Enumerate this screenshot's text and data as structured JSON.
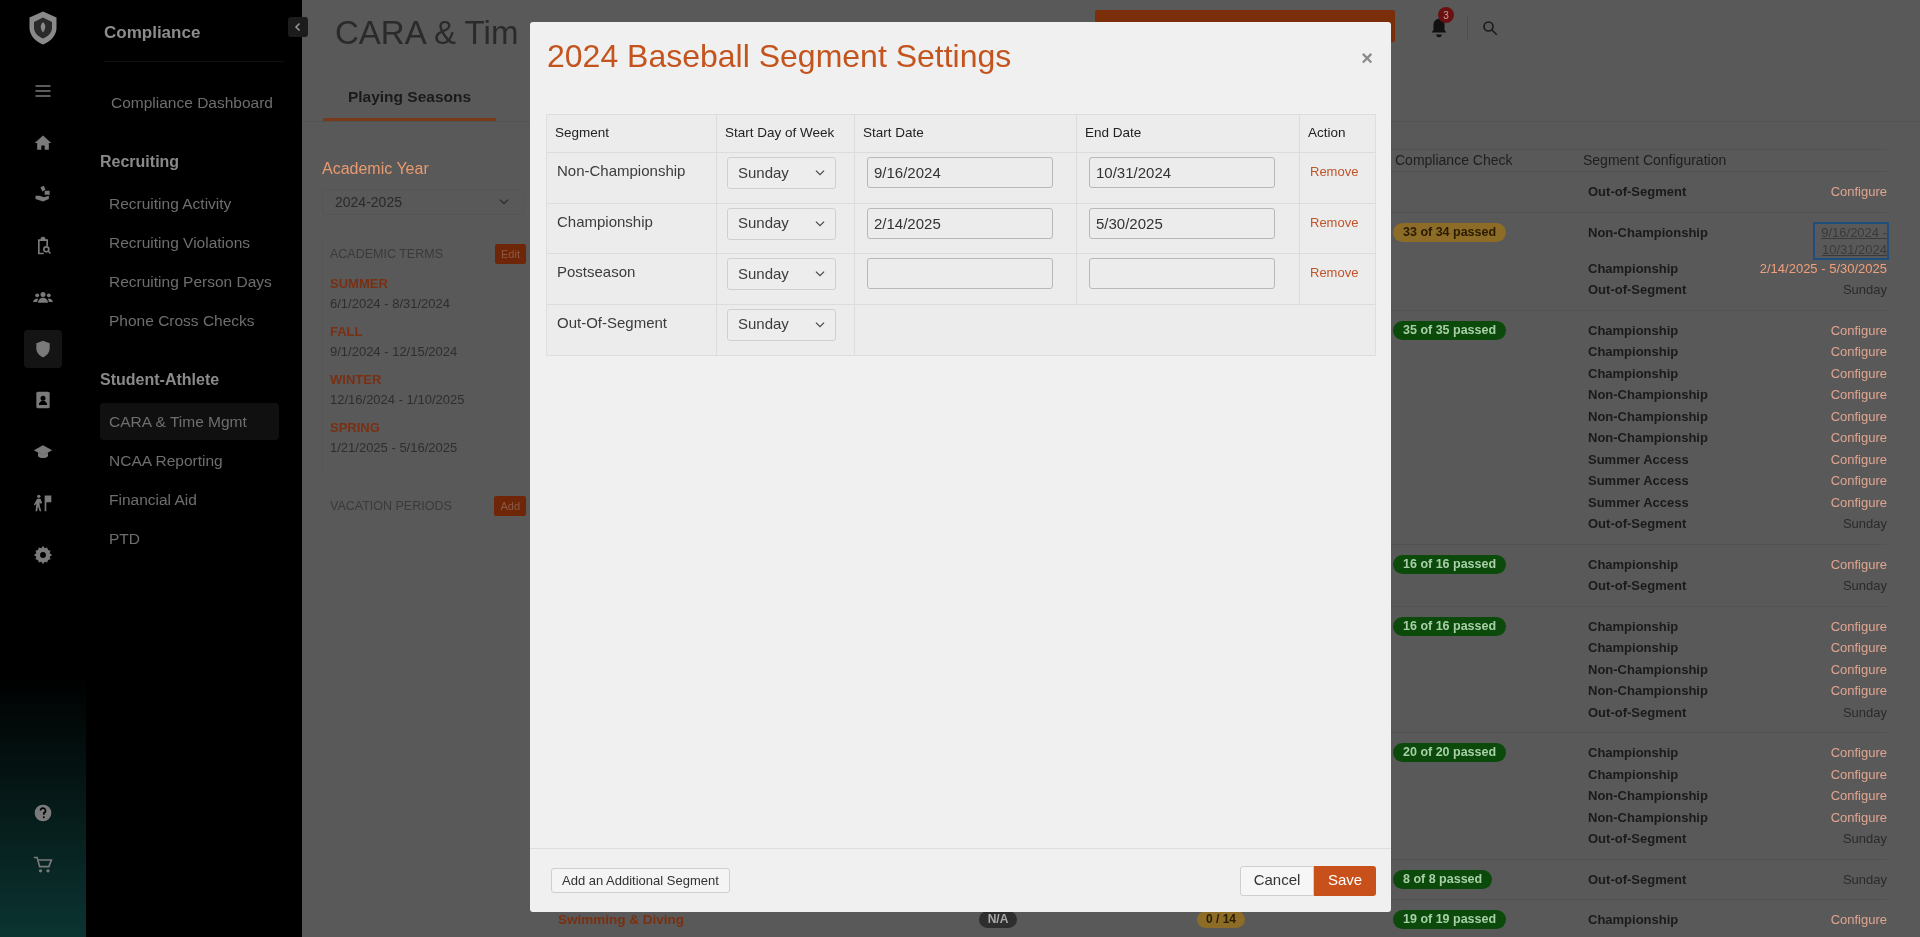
{
  "rail": {
    "top": [
      {
        "selected": false
      },
      {
        "selected": false
      },
      {
        "selected": false
      },
      {
        "selected": false
      },
      {
        "selected": false
      },
      {
        "selected": true
      },
      {
        "selected": false
      },
      {
        "selected": false
      },
      {
        "selected": false
      },
      {
        "selected": false
      }
    ],
    "bottom": [
      {
        "selected": false
      },
      {
        "selected": false
      }
    ]
  },
  "sidebar": {
    "title": "Compliance",
    "sections": [
      {
        "items": [
          {
            "label": "Compliance Dashboard",
            "selected": false
          }
        ]
      },
      {
        "heading": "Recruiting",
        "items": [
          {
            "label": "Recruiting Activity",
            "selected": false
          },
          {
            "label": "Recruiting Violations",
            "selected": false
          },
          {
            "label": "Recruiting Person Days",
            "selected": false
          },
          {
            "label": "Phone Cross Checks",
            "selected": false
          }
        ]
      },
      {
        "heading": "Student-Athlete",
        "items": [
          {
            "label": "CARA & Time Mgmt",
            "selected": true
          },
          {
            "label": "NCAA Reporting",
            "selected": false
          },
          {
            "label": "Financial Aid",
            "selected": false
          },
          {
            "label": "PTD",
            "selected": false
          }
        ]
      }
    ]
  },
  "header": {
    "title": "CARA & Tim",
    "notifications": "3"
  },
  "tabs": [
    {
      "label": "Playing Seasons",
      "selected": true
    }
  ],
  "academic": {
    "label": "Academic Year",
    "year": "2024-2025",
    "terms_heading": "ACADEMIC TERMS",
    "edit": "Edit",
    "terms": [
      {
        "name": "SUMMER",
        "dates": "6/1/2024 - 8/31/2024"
      },
      {
        "name": "FALL",
        "dates": "9/1/2024 - 12/15/2024"
      },
      {
        "name": "WINTER",
        "dates": "12/16/2024 - 1/10/2025"
      },
      {
        "name": "SPRING",
        "dates": "1/21/2025 - 5/16/2025"
      }
    ],
    "vacation_heading": "VACATION PERIODS",
    "add": "Add"
  },
  "seasons": {
    "columns": [
      "Compliance Check",
      "Segment Configuration"
    ],
    "groups": [
      {
        "segments": [
          {
            "segment": "Out-of-Segment",
            "value": "Configure",
            "kind": "link"
          }
        ]
      },
      {
        "check": {
          "text": "33 of 34 passed",
          "color": "#8c6c26"
        },
        "segments": [
          {
            "segment": "Non-Championship",
            "value": "9/16/2024 - 10/31/2024",
            "kind": "focused-range"
          },
          {
            "segment": "Championship",
            "value": "2/14/2025 - 5/30/2025",
            "kind": "range"
          },
          {
            "segment": "Out-of-Segment",
            "value": "Sunday",
            "kind": "day"
          }
        ]
      },
      {
        "check": {
          "text": "35 of 35 passed",
          "color": "#0b4a0b"
        },
        "segments": [
          {
            "segment": "Championship",
            "value": "Configure",
            "kind": "link"
          },
          {
            "segment": "Championship",
            "value": "Configure",
            "kind": "link"
          },
          {
            "segment": "Championship",
            "value": "Configure",
            "kind": "link"
          },
          {
            "segment": "Non-Championship",
            "value": "Configure",
            "kind": "link"
          },
          {
            "segment": "Non-Championship",
            "value": "Configure",
            "kind": "link"
          },
          {
            "segment": "Non-Championship",
            "value": "Configure",
            "kind": "link"
          },
          {
            "segment": "Summer Access",
            "value": "Configure",
            "kind": "link"
          },
          {
            "segment": "Summer Access",
            "value": "Configure",
            "kind": "link"
          },
          {
            "segment": "Summer Access",
            "value": "Configure",
            "kind": "link"
          },
          {
            "segment": "Out-of-Segment",
            "value": "Sunday",
            "kind": "day"
          }
        ]
      },
      {
        "check": {
          "text": "16 of 16 passed",
          "color": "#0b4a0b"
        },
        "segments": [
          {
            "segment": "Championship",
            "value": "Configure",
            "kind": "link"
          },
          {
            "segment": "Out-of-Segment",
            "value": "Sunday",
            "kind": "day"
          }
        ]
      },
      {
        "check": {
          "text": "16 of 16 passed",
          "color": "#0b4a0b"
        },
        "segments": [
          {
            "segment": "Championship",
            "value": "Configure",
            "kind": "link"
          },
          {
            "segment": "Championship",
            "value": "Configure",
            "kind": "link"
          },
          {
            "segment": "Non-Championship",
            "value": "Configure",
            "kind": "link"
          },
          {
            "segment": "Non-Championship",
            "value": "Configure",
            "kind": "link"
          },
          {
            "segment": "Out-of-Segment",
            "value": "Sunday",
            "kind": "day"
          }
        ]
      },
      {
        "check": {
          "text": "20 of 20 passed",
          "color": "#0b4a0b"
        },
        "segments": [
          {
            "segment": "Championship",
            "value": "Configure",
            "kind": "link"
          },
          {
            "segment": "Championship",
            "value": "Configure",
            "kind": "link"
          },
          {
            "segment": "Non-Championship",
            "value": "Configure",
            "kind": "link"
          },
          {
            "segment": "Non-Championship",
            "value": "Configure",
            "kind": "link"
          },
          {
            "segment": "Out-of-Segment",
            "value": "Sunday",
            "kind": "day"
          }
        ]
      },
      {
        "check": {
          "text": "8 of 8 passed",
          "color": "#0b4a0b"
        },
        "segments": [
          {
            "segment": "Out-of-Segment",
            "value": "Sunday",
            "kind": "day"
          }
        ]
      },
      {
        "sport": "Swimming & Diving",
        "column_3": {
          "text": "N/A",
          "color": "#2e2e2e"
        },
        "column_4": {
          "text": "0 / 14",
          "color": "#8c6c26"
        },
        "check": {
          "text": "19 of 19 passed",
          "color": "#0b4a0b"
        },
        "segments": [
          {
            "segment": "Championship",
            "value": "Configure",
            "kind": "link"
          }
        ]
      }
    ]
  },
  "modal": {
    "title": "2024 Baseball Segment Settings",
    "close": "×",
    "columns": [
      "Segment",
      "Start Day of Week",
      "Start Date",
      "End Date",
      "Action"
    ],
    "rows": [
      {
        "segment": "Non-Championship",
        "kind": "dated",
        "start_day": "Sunday",
        "start_date": "9/16/2024",
        "end_date": "10/31/2024",
        "action": "Remove"
      },
      {
        "segment": "Championship",
        "kind": "dated",
        "start_day": "Sunday",
        "start_date": "2/14/2025",
        "end_date": "5/30/2025",
        "action": "Remove"
      },
      {
        "segment": "Postseason",
        "kind": "dated",
        "start_day": "Sunday",
        "action": "Remove"
      },
      {
        "segment": "Out-Of-Segment",
        "kind": "undated",
        "start_day": "Sunday"
      }
    ],
    "add_button": "Add an Additional Segment",
    "cancel": "Cancel",
    "save": "Save"
  }
}
